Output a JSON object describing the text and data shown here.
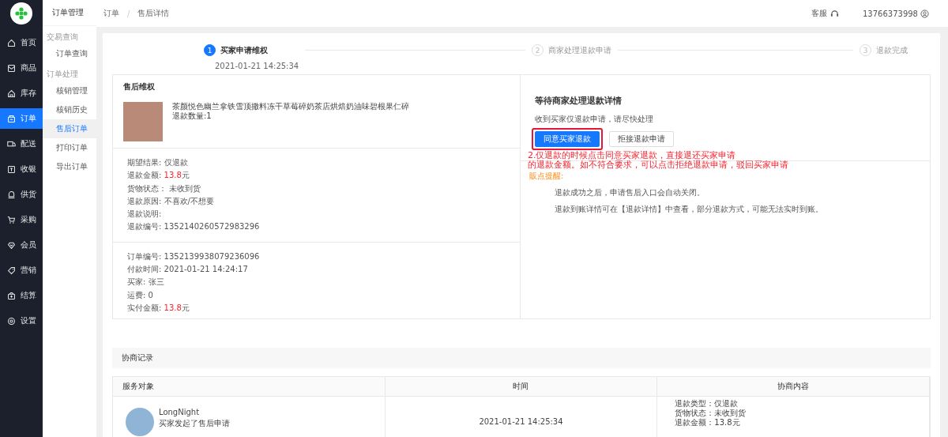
{
  "nav": {
    "items": [
      {
        "label": "首页",
        "selected": false
      },
      {
        "label": "商品",
        "selected": false
      },
      {
        "label": "库存",
        "selected": false
      },
      {
        "label": "订单",
        "selected": true
      },
      {
        "label": "配送",
        "selected": false
      },
      {
        "label": "收银",
        "selected": false
      },
      {
        "label": "供货",
        "selected": false
      },
      {
        "label": "采购",
        "selected": false
      },
      {
        "label": "会员",
        "selected": false
      },
      {
        "label": "营销",
        "selected": false
      },
      {
        "label": "结算",
        "selected": false
      },
      {
        "label": "设置",
        "selected": false
      }
    ]
  },
  "submenu": {
    "title": "订单管理",
    "groups": [
      {
        "heading": "交易查询",
        "items": [
          {
            "label": "订单查询",
            "selected": false
          }
        ]
      },
      {
        "heading": "订单处理",
        "items": [
          {
            "label": "核销管理",
            "selected": false
          },
          {
            "label": "核销历史",
            "selected": false
          },
          {
            "label": "售后订单",
            "selected": true
          },
          {
            "label": "打印订单",
            "selected": false
          },
          {
            "label": "导出订单",
            "selected": false
          }
        ]
      }
    ]
  },
  "header": {
    "breadcrumb": [
      "订单",
      "售后详情"
    ],
    "separator": "/",
    "service": "客服",
    "account": "13766373998"
  },
  "steps": [
    {
      "number": "1",
      "label": "买家申请维权",
      "time": "2021-01-21 14:25:34",
      "active": true
    },
    {
      "number": "2",
      "label": "商家处理退款申请",
      "active": false
    },
    {
      "number": "3",
      "label": "退款完成",
      "active": false
    }
  ],
  "aftersale": {
    "title": "售后维权",
    "product_name": "茶颜悦色幽兰拿铁雪顶撒料冻干草莓碎奶茶店烘焙奶油味碧根果仁碎",
    "quantity": "退款数量:1",
    "sections": [
      [
        {
          "label": "期望结果:",
          "value": "仅退款",
          "kind": "plain"
        },
        {
          "label": "退款金额:",
          "value": "13.8",
          "unit": "元",
          "kind": "amount"
        },
        {
          "label": "货物状态：",
          "value": "未收到货",
          "kind": "plain"
        },
        {
          "label": "退款原因:",
          "value": "不喜欢/不想要",
          "kind": "plain"
        },
        {
          "label": "退款说明:",
          "kind": "plain"
        },
        {
          "label": "退款编号:",
          "value": "1352140260572983296",
          "kind": "plain"
        }
      ],
      [
        {
          "label": "订单编号:",
          "value": "1352139938079236096",
          "kind": "plain"
        },
        {
          "label": "付款时间:",
          "value": "2021-01-21 14:24:17",
          "kind": "plain"
        },
        {
          "label": "买家:",
          "value": "张三",
          "kind": "plain"
        },
        {
          "label": "运费:",
          "value": "0",
          "kind": "plain"
        },
        {
          "label": "实付金额:",
          "value": "13.8",
          "unit": "元",
          "kind": "amount"
        }
      ]
    ]
  },
  "process": {
    "title": "等待商家处理退款详情",
    "subtitle": "收到买家仅退款申请，请尽快处理",
    "buttons": [
      {
        "label": "同意买家退款",
        "kind": "primary",
        "highlighted": true
      },
      {
        "label": "拒接退款申请",
        "kind": "default",
        "highlighted": false
      }
    ],
    "annotation": [
      "2.仅退款的时候点击同意买家退款，直接退还买家申请",
      "的退款金额。如不符合要求，可以点击拒绝退款申请，驳回买家申请"
    ],
    "tips_title": "販点提醒:",
    "tips": [
      "退款成功之后，申请售后入口会自动关闭。",
      "退款到账详情可在【退款详情】中查看，部分退款方式，可能无法实时到账。"
    ]
  },
  "records": {
    "title": "协商记录",
    "columns": [
      "服务对象",
      "时间",
      "协商内容"
    ],
    "rows": [
      {
        "name": "LongNight",
        "action": "买家发起了售后申请",
        "time": "2021-01-21 14:25:34",
        "content": [
          "退款类型：仅退款",
          "货物状态：未收到货",
          "退款金额：13.8元"
        ]
      }
    ]
  }
}
